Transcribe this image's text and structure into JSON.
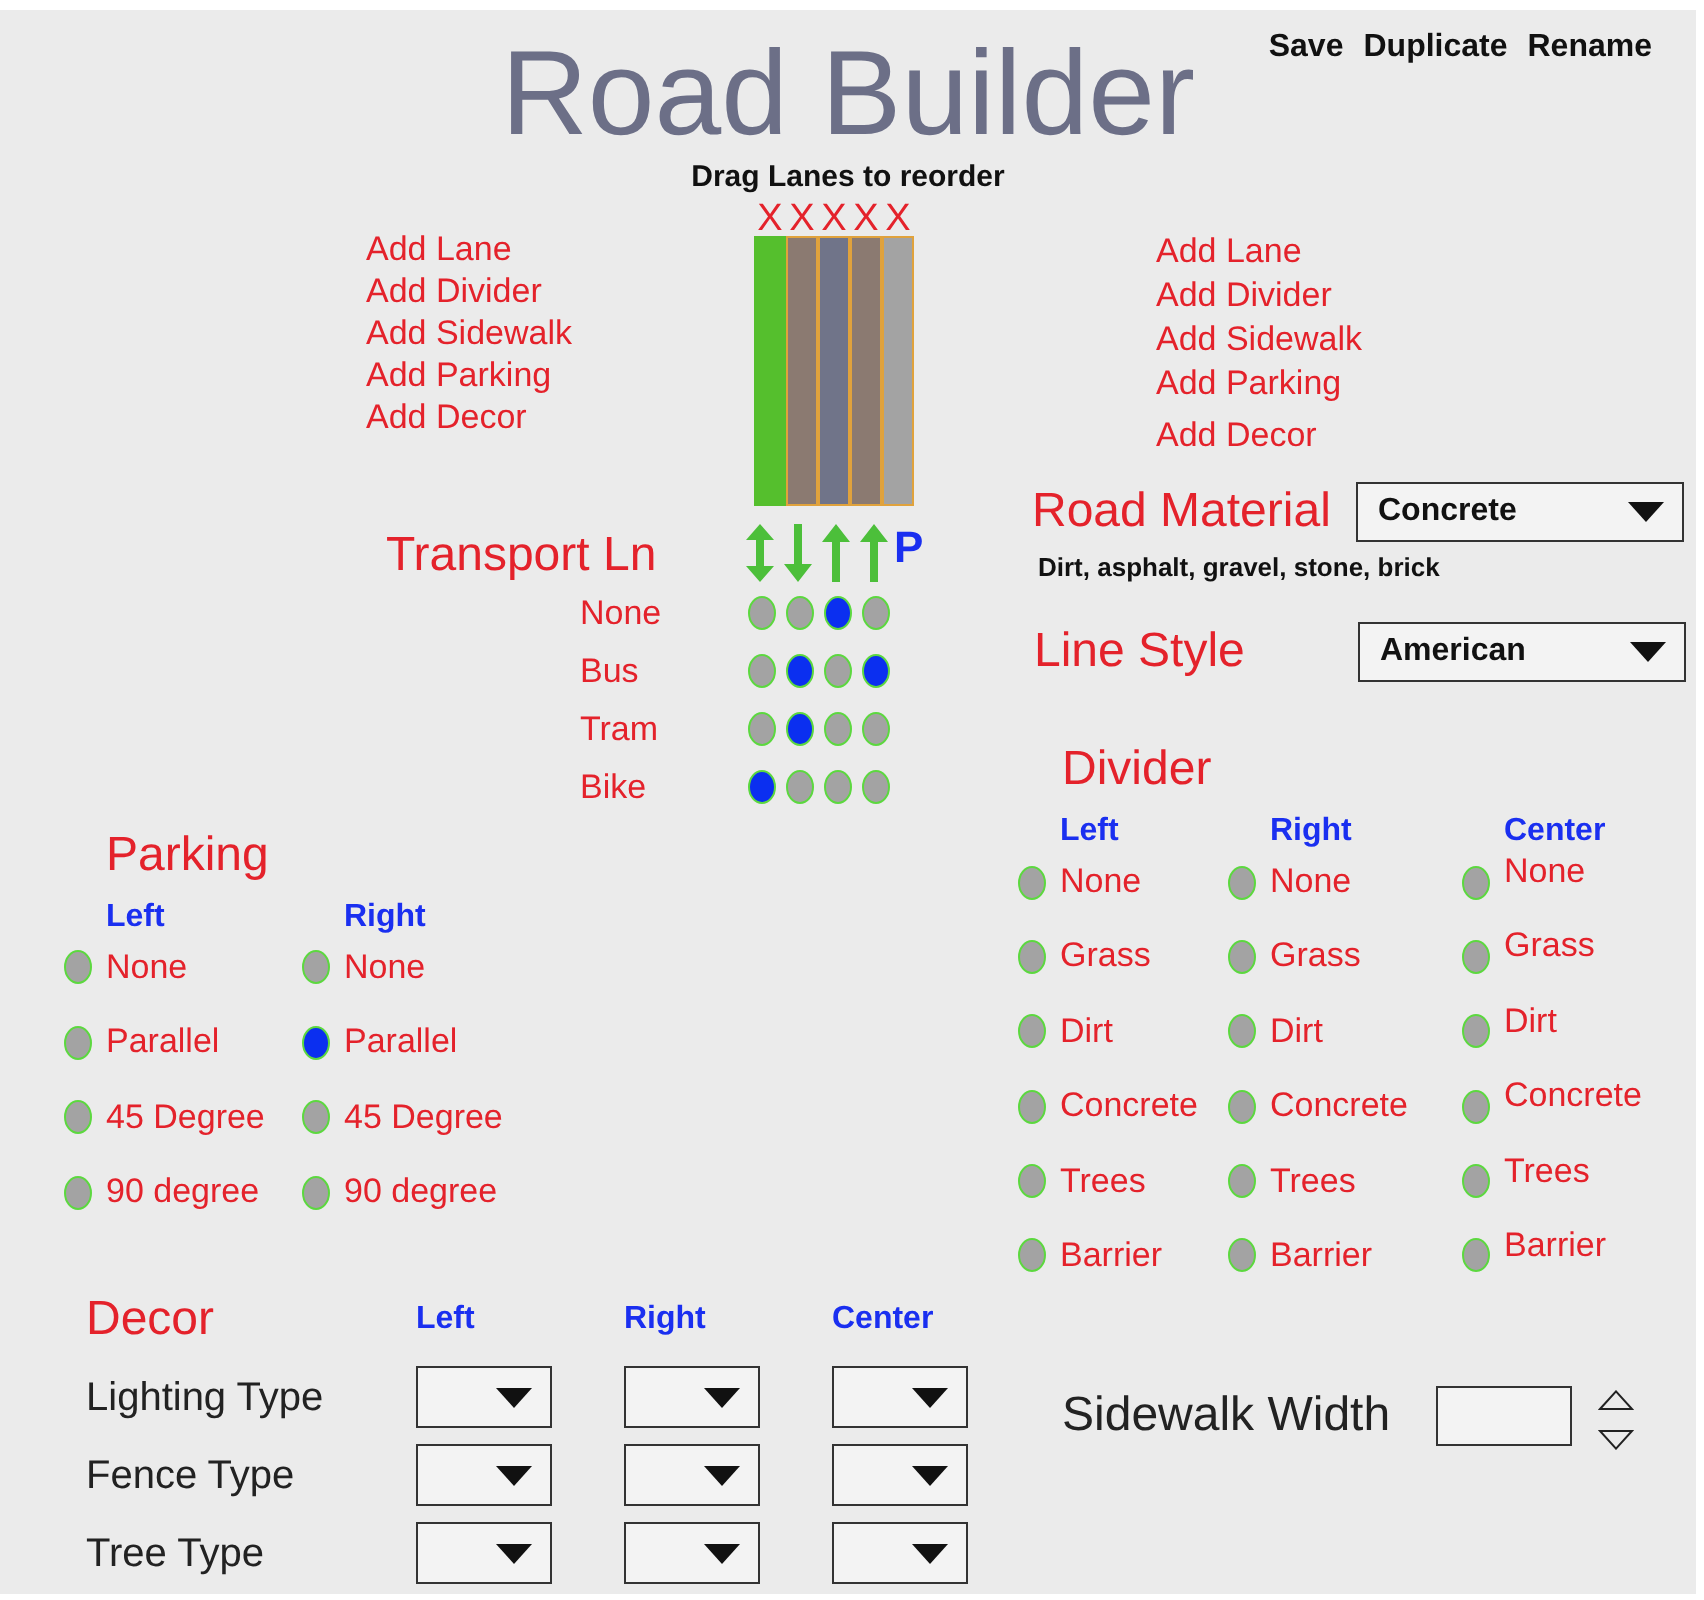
{
  "header": {
    "title": "Road Builder",
    "actions": [
      "Save",
      "Duplicate",
      "Rename"
    ],
    "hint": "Drag Lanes to reorder"
  },
  "add_menus": [
    {
      "items": [
        "Add Lane",
        "Add Divider",
        "Add Sidewalk",
        "Add Parking",
        "Add Decor"
      ]
    },
    {
      "items": [
        "Add Lane",
        "Add Divider",
        "Add Sidewalk",
        "Add Parking",
        "Add Decor"
      ]
    }
  ],
  "lane_builder": {
    "lanes": [
      {
        "remove": "X",
        "color": "#55bf2d",
        "highlighted": false
      },
      {
        "remove": "X",
        "color": "#8b7a71",
        "highlighted": true
      },
      {
        "remove": "X",
        "color": "#707489",
        "highlighted": true
      },
      {
        "remove": "X",
        "color": "#8b7a71",
        "highlighted": true
      },
      {
        "remove": "X",
        "color": "#a3a3a3",
        "highlighted": true
      }
    ]
  },
  "transport": {
    "title": "Transport Ln",
    "markers": [
      {
        "kind": "both"
      },
      {
        "kind": "down"
      },
      {
        "kind": "up"
      },
      {
        "kind": "up"
      },
      {
        "kind": "parking",
        "label": "P"
      }
    ],
    "options": [
      {
        "label": "None",
        "lanes": [
          {
            "selected": false
          },
          {
            "selected": false
          },
          {
            "selected": true
          },
          {
            "selected": false
          }
        ]
      },
      {
        "label": "Bus",
        "lanes": [
          {
            "selected": false
          },
          {
            "selected": true
          },
          {
            "selected": false
          },
          {
            "selected": true
          }
        ]
      },
      {
        "label": "Tram",
        "lanes": [
          {
            "selected": false
          },
          {
            "selected": true
          },
          {
            "selected": false
          },
          {
            "selected": false
          }
        ]
      },
      {
        "label": "Bike",
        "lanes": [
          {
            "selected": true
          },
          {
            "selected": false
          },
          {
            "selected": false
          },
          {
            "selected": false
          }
        ]
      }
    ]
  },
  "road_material": {
    "label": "Road Material",
    "value": "Concrete",
    "hint": "Dirt, asphalt, gravel, stone, brick"
  },
  "line_style": {
    "label": "Line Style",
    "value": "American"
  },
  "divider": {
    "title": "Divider",
    "columns": [
      {
        "heading": "Left",
        "options": [
          {
            "label": "None",
            "selected": false
          },
          {
            "label": "Grass",
            "selected": false
          },
          {
            "label": "Dirt",
            "selected": false
          },
          {
            "label": "Concrete",
            "selected": false
          },
          {
            "label": "Trees",
            "selected": false
          },
          {
            "label": "Barrier",
            "selected": false
          }
        ]
      },
      {
        "heading": "Right",
        "options": [
          {
            "label": "None",
            "selected": false
          },
          {
            "label": "Grass",
            "selected": false
          },
          {
            "label": "Dirt",
            "selected": false
          },
          {
            "label": "Concrete",
            "selected": false
          },
          {
            "label": "Trees",
            "selected": false
          },
          {
            "label": "Barrier",
            "selected": false
          }
        ]
      },
      {
        "heading": "Center",
        "options": [
          {
            "label": "None",
            "selected": false
          },
          {
            "label": "Grass",
            "selected": false
          },
          {
            "label": "Dirt",
            "selected": false
          },
          {
            "label": "Concrete",
            "selected": false
          },
          {
            "label": "Trees",
            "selected": false
          },
          {
            "label": "Barrier",
            "selected": false
          }
        ]
      }
    ]
  },
  "parking": {
    "title": "Parking",
    "columns": [
      {
        "heading": "Left",
        "options": [
          {
            "label": "None",
            "selected": false
          },
          {
            "label": "Parallel",
            "selected": false
          },
          {
            "label": "45 Degree",
            "selected": false
          },
          {
            "label": "90 degree",
            "selected": false
          }
        ]
      },
      {
        "heading": "Right",
        "options": [
          {
            "label": "None",
            "selected": false
          },
          {
            "label": "Parallel",
            "selected": true
          },
          {
            "label": "45 Degree",
            "selected": false
          },
          {
            "label": "90 degree",
            "selected": false
          }
        ]
      }
    ]
  },
  "decor": {
    "title": "Decor",
    "columns": [
      "Left",
      "Right",
      "Center"
    ],
    "rows": [
      {
        "label": "Lighting Type"
      },
      {
        "label": "Fence Type"
      },
      {
        "label": "Tree Type"
      }
    ]
  },
  "sidewalk": {
    "label": "Sidewalk Width"
  }
}
